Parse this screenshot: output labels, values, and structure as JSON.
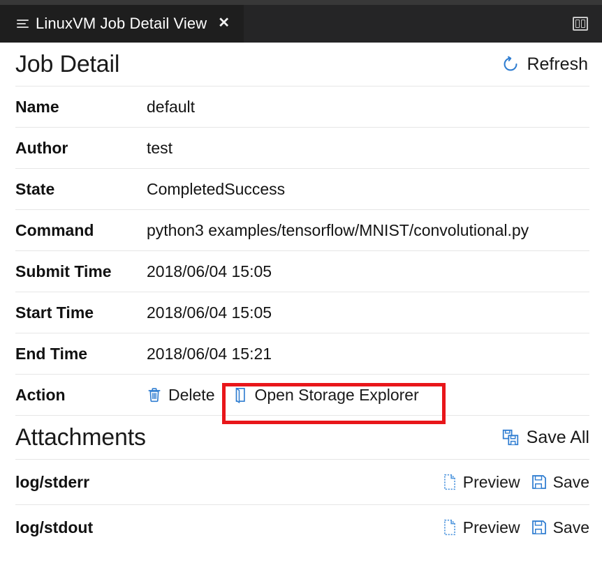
{
  "window": {
    "tab": {
      "icon": "list-lines-icon",
      "title": "LinuxVM Job Detail View",
      "close_label": "✕"
    },
    "actions": {
      "split_editor_icon": "split-editor-icon"
    },
    "colors": {
      "tabbar_bg": "#252526",
      "tab_active_bg": "#1e1e1e",
      "top_strip": "#383838",
      "accent_blue": "#2f7dd1",
      "highlight_red": "#e8161a",
      "divider": "#e6e6e6"
    }
  },
  "job_detail": {
    "title": "Job Detail",
    "refresh": {
      "label": "Refresh",
      "icon": "refresh-icon"
    },
    "rows": [
      {
        "label": "Name",
        "value": "default"
      },
      {
        "label": "Author",
        "value": "test"
      },
      {
        "label": "State",
        "value": "CompletedSuccess"
      },
      {
        "label": "Command",
        "value": "python3 examples/tensorflow/MNIST/convolutional.py"
      },
      {
        "label": "Submit Time",
        "value": "2018/06/04 15:05"
      },
      {
        "label": "Start Time",
        "value": "2018/06/04 15:05"
      },
      {
        "label": "End Time",
        "value": "2018/06/04 15:21"
      }
    ],
    "action_row": {
      "label": "Action",
      "buttons": [
        {
          "label": "Delete",
          "icon": "trash-icon"
        },
        {
          "label": "Open Storage Explorer",
          "icon": "open-folder-icon",
          "highlighted": true
        }
      ]
    }
  },
  "attachments": {
    "title": "Attachments",
    "save_all": {
      "label": "Save All",
      "icon": "save-all-icon"
    },
    "items": [
      {
        "name": "log/stderr",
        "preview": {
          "label": "Preview",
          "icon": "preview-file-icon"
        },
        "save": {
          "label": "Save",
          "icon": "save-floppy-icon"
        }
      },
      {
        "name": "log/stdout",
        "preview": {
          "label": "Preview",
          "icon": "preview-file-icon"
        },
        "save": {
          "label": "Save",
          "icon": "save-floppy-icon"
        }
      }
    ]
  }
}
